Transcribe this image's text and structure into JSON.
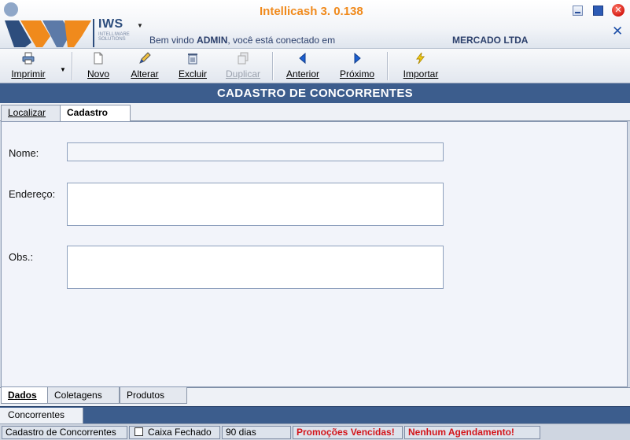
{
  "header": {
    "brand": "IWS",
    "brand_sub": "INTELLIWARE SOLUTIONS",
    "app_title": "Intellicash 3. 0.138",
    "welcome_prefix": "Bem vindo ",
    "user": "ADMIN",
    "welcome_suffix": ", você está conectado em",
    "company": "MERCADO LTDA"
  },
  "toolbar": {
    "print": "Imprimir",
    "new": "Novo",
    "edit": "Alterar",
    "delete": "Excluir",
    "duplicate": "Duplicar",
    "previous": "Anterior",
    "next": "Próximo",
    "import": "Importar"
  },
  "section_title": "CADASTRO DE CONCORRENTES",
  "top_tabs": {
    "locate": "Localizar",
    "register": "Cadastro"
  },
  "form": {
    "name_label": "Nome:",
    "name_value": "",
    "address_label": "Endereço:",
    "address_value": "",
    "obs_label": "Obs.:",
    "obs_value": ""
  },
  "bottom_tabs": {
    "data": "Dados",
    "collections": "Coletagens",
    "products": "Produtos"
  },
  "window_tab": "Concorrentes",
  "statusbar": {
    "screen": "Cadastro de Concorrentes",
    "cashier": "Caixa Fechado",
    "days": "90 dias",
    "promotions": "Promoções Vencidas!",
    "scheduling": "Nenhum Agendamento!"
  },
  "colors": {
    "title_orange": "#f08a1c",
    "navy": "#3c5d8d",
    "alert_red": "#d4151a"
  }
}
